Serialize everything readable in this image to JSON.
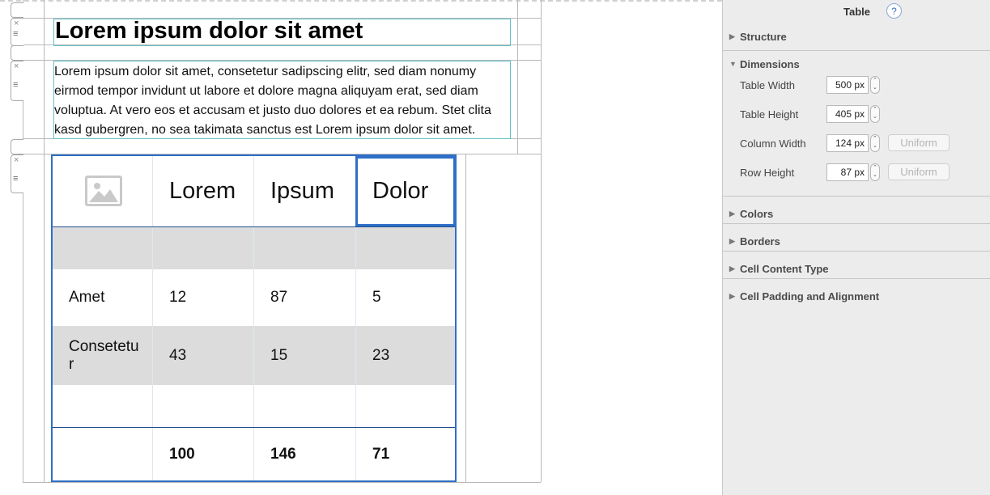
{
  "document": {
    "heading": "Lorem ipsum dolor sit amet",
    "paragraph": "Lorem ipsum dolor sit amet, consetetur sadipscing elitr, sed diam nonumy eirmod tempor invidunt ut labore et dolore magna aliquyam erat, sed diam voluptua. At vero eos et accusam et justo duo dolores et ea rebum. Stet clita kasd gubergren, no sea takimata sanctus est Lorem ipsum dolor sit amet."
  },
  "block_controls": {
    "remove_icon": "×",
    "drag_icon": "≡"
  },
  "table": {
    "headers": [
      "",
      "Lorem",
      "Ipsum",
      "Dolor"
    ],
    "rows": [
      [
        "",
        "",
        "",
        ""
      ],
      [
        "Amet",
        "12",
        "87",
        "5"
      ],
      [
        "Consetetur",
        "43",
        "15",
        "23"
      ],
      [
        "",
        "",
        "",
        ""
      ]
    ],
    "totals": [
      "",
      "100",
      "146",
      "71"
    ],
    "selected_cell": "Dolor",
    "image_placeholder_icon": "image-placeholder-icon"
  },
  "inspector": {
    "title": "Table",
    "help": "?",
    "sections": {
      "structure": "Structure",
      "dimensions": "Dimensions",
      "colors": "Colors",
      "borders": "Borders",
      "cell_content_type": "Cell Content Type",
      "cell_padding": "Cell Padding and Alignment"
    },
    "dimensions": {
      "table_width_label": "Table Width",
      "table_width": "500 px",
      "table_height_label": "Table Height",
      "table_height": "405 px",
      "column_width_label": "Column Width",
      "column_width": "124 px",
      "row_height_label": "Row Height",
      "row_height": "87 px",
      "uniform_label": "Uniform"
    }
  },
  "colors": {
    "selection": "#2e6fc7",
    "gray_row": "#dcdcdc",
    "guide_teal": "#5fc2c7",
    "panel_bg": "#ececec"
  }
}
